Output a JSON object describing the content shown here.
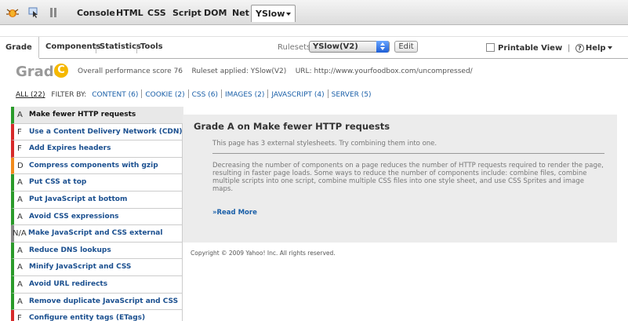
{
  "firebug": {
    "tabs": [
      "Console",
      "HTML",
      "CSS",
      "Script",
      "DOM",
      "Net"
    ],
    "active_tab": "YSlow"
  },
  "toolbar": {
    "tabs": {
      "grade": "Grade",
      "components": "Components",
      "statistics": "Statistics",
      "tools": "Tools"
    },
    "rulesets_label": "Rulesets",
    "rulesets_value": "YSlow(V2)",
    "edit_label": "Edit",
    "printable_label": "Printable View",
    "help_label": "Help"
  },
  "grade": {
    "heading": "Grade",
    "letter": "C",
    "overall": "Overall performance score 76",
    "ruleset": "Ruleset applied: YSlow(V2)",
    "url": "URL: http://www.yourfoodbox.com/uncompressed/"
  },
  "filters": {
    "all": "ALL (22)",
    "label": "FILTER BY:",
    "items": [
      "CONTENT (6)",
      "COOKIE (2)",
      "CSS (6)",
      "IMAGES (2)",
      "JAVASCRIPT (4)",
      "SERVER (5)"
    ]
  },
  "rules": [
    {
      "grade": "A",
      "title": "Make fewer HTTP requests",
      "color": "#2a9a2a"
    },
    {
      "grade": "F",
      "title": "Use a Content Delivery Network (CDN)",
      "color": "#d62a2a"
    },
    {
      "grade": "F",
      "title": "Add Expires headers",
      "color": "#d62a2a"
    },
    {
      "grade": "D",
      "title": "Compress components with gzip",
      "color": "#f08a1c"
    },
    {
      "grade": "A",
      "title": "Put CSS at top",
      "color": "#2a9a2a"
    },
    {
      "grade": "A",
      "title": "Put JavaScript at bottom",
      "color": "#2a9a2a"
    },
    {
      "grade": "A",
      "title": "Avoid CSS expressions",
      "color": "#2a9a2a"
    },
    {
      "grade": "N/A",
      "title": "Make JavaScript and CSS external",
      "color": "#888888"
    },
    {
      "grade": "A",
      "title": "Reduce DNS lookups",
      "color": "#2a9a2a"
    },
    {
      "grade": "A",
      "title": "Minify JavaScript and CSS",
      "color": "#2a9a2a"
    },
    {
      "grade": "A",
      "title": "Avoid URL redirects",
      "color": "#2a9a2a"
    },
    {
      "grade": "A",
      "title": "Remove duplicate JavaScript and CSS",
      "color": "#2a9a2a"
    },
    {
      "grade": "F",
      "title": "Configure entity tags (ETags)",
      "color": "#d62a2a"
    }
  ],
  "detail": {
    "title": "Grade A on Make fewer HTTP requests",
    "message": "This page has 3 external stylesheets. Try combining them into one.",
    "description": "Decreasing the number of components on a page reduces the number of HTTP requests required to render the page, resulting in faster page loads. Some ways to reduce the number of components include: combine files, combine multiple scripts into one script, combine multiple CSS files into one style sheet, and use CSS Sprites and image maps.",
    "read_more": "»Read More"
  },
  "copyright": "Copyright © 2009 Yahoo! Inc. All rights reserved."
}
